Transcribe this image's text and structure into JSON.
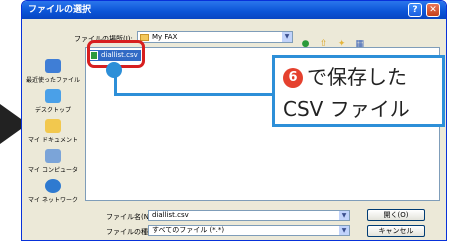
{
  "window": {
    "title": "ファイルの選択",
    "help_label": "?",
    "close_label": "✕"
  },
  "toolbar": {
    "lookin_label": "ファイルの場所(I):",
    "lookin_value": "My FAX",
    "combo_arrow": "▼",
    "icons": [
      "back-icon",
      "up-folder-icon",
      "new-folder-icon",
      "view-menu-icon"
    ]
  },
  "places": [
    {
      "label": "最近使ったファイル",
      "icon": "recent-icon"
    },
    {
      "label": "デスクトップ",
      "icon": "desktop-icon"
    },
    {
      "label": "マイ ドキュメント",
      "icon": "my-documents-icon"
    },
    {
      "label": "マイ コンピュータ",
      "icon": "my-computer-icon"
    },
    {
      "label": "マイ ネットワーク",
      "icon": "my-network-icon"
    }
  ],
  "files": [
    {
      "name": "diallist.csv",
      "selected": true
    }
  ],
  "bottom": {
    "filename_label": "ファイル名(N):",
    "filename_value": "diallist.csv",
    "filetype_label": "ファイルの種類(T):",
    "filetype_value": "すべてのファイル (*.*)",
    "open_label": "開く(O)",
    "cancel_label": "キャンセル"
  },
  "annotation": {
    "step_number": "6",
    "line1": "で保存した",
    "line2": "CSV ファイル",
    "accent_color": "#2d8fd8",
    "highlight_color": "#d71f1f"
  }
}
